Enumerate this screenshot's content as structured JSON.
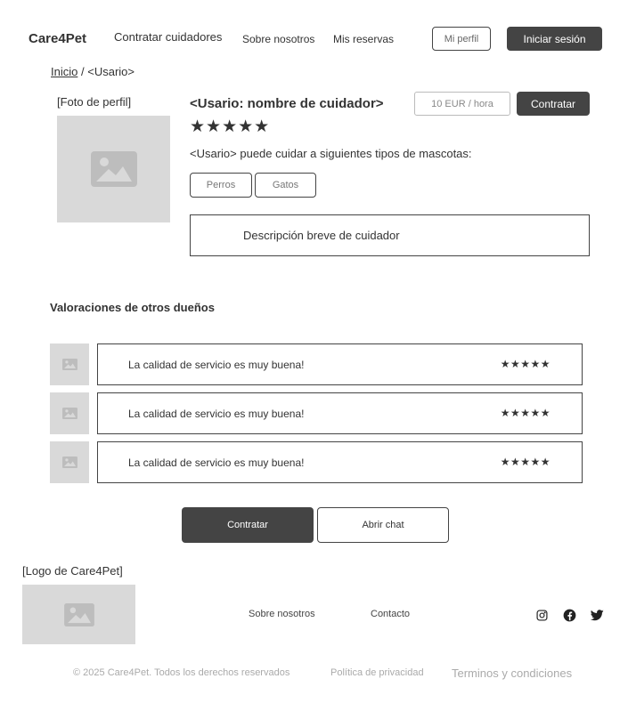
{
  "header": {
    "brand": "Care4Pet",
    "nav": {
      "hire": "Contratar cuidadores",
      "about": "Sobre nosotros",
      "bookings": "Mis reservas"
    },
    "profile_button": "Mi perfil",
    "login_button": "Iniciar sesión"
  },
  "breadcrumb": {
    "home": "Inicio",
    "separator": "/",
    "current": "<Usario>"
  },
  "profile": {
    "photo_caption": "[Foto de perfil]",
    "name": "<Usario: nombre de cuidador>",
    "price": "10 EUR / hora",
    "hire_button": "Contratar",
    "stars": "★★★★★",
    "rating": 5,
    "pets_text": "<Usario> puede cuidar a siguientes tipos de mascotas:",
    "pets": [
      "Perros",
      "Gatos"
    ],
    "description": "Descripción breve de cuidador"
  },
  "reviews": {
    "title": "Valoraciones de otros dueños",
    "items": [
      {
        "text": "La calidad de servicio es muy buena!",
        "stars": "★★★★★",
        "rating": 5
      },
      {
        "text": "La calidad de servicio es muy buena!",
        "stars": "★★★★★",
        "rating": 5
      },
      {
        "text": "La calidad de servicio es muy buena!",
        "stars": "★★★★★",
        "rating": 5
      }
    ]
  },
  "actions": {
    "hire": "Contratar",
    "chat": "Abrir chat"
  },
  "footer": {
    "logo_caption": "[Logo de Care4Pet]",
    "about": "Sobre nosotros",
    "contact": "Contacto",
    "social_icons": [
      "instagram-icon",
      "facebook-icon",
      "twitter-icon"
    ],
    "copyright": "© 2025 Care4Pet. Todos los derechos reservados",
    "privacy": "Política de privacidad",
    "terms": "Terminos y condiciones"
  },
  "colors": {
    "dark_button": "#444444",
    "placeholder_gray": "#d9d9d9",
    "border": "#444444",
    "muted_text": "#aaaaaa"
  }
}
